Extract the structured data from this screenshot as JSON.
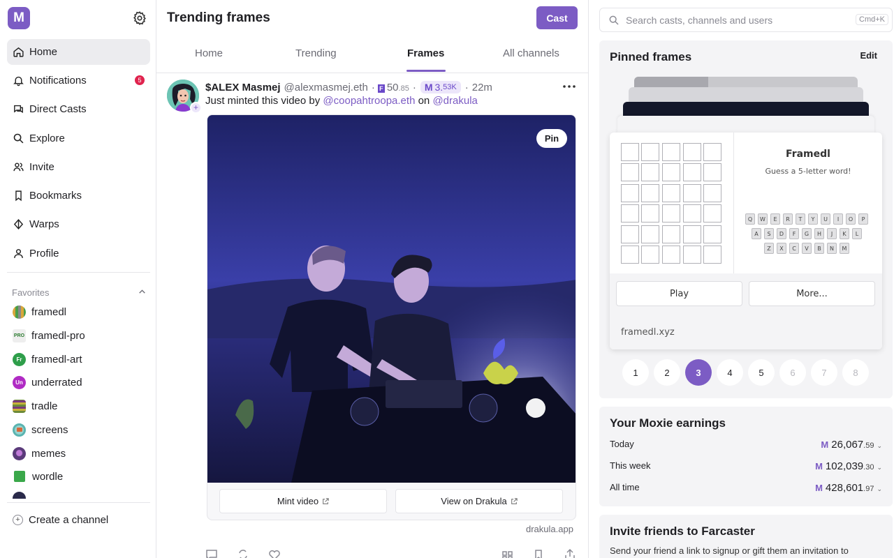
{
  "app": {
    "logo_letter": "M"
  },
  "sidebar": {
    "nav": [
      {
        "label": "Home",
        "icon": "home-icon"
      },
      {
        "label": "Notifications",
        "icon": "bell-icon",
        "badge": "5"
      },
      {
        "label": "Direct Casts",
        "icon": "chat-icon"
      },
      {
        "label": "Explore",
        "icon": "search-icon"
      },
      {
        "label": "Invite",
        "icon": "users-icon"
      },
      {
        "label": "Bookmarks",
        "icon": "bookmark-icon"
      },
      {
        "label": "Warps",
        "icon": "diamond-icon"
      },
      {
        "label": "Profile",
        "icon": "user-icon"
      }
    ],
    "favorites_label": "Favorites",
    "favorites": [
      {
        "label": "framedl",
        "icon_text": "",
        "color": "#d9a63a"
      },
      {
        "label": "framedl-pro",
        "icon_text": "PRO",
        "color": "#eeeeee"
      },
      {
        "label": "framedl-art",
        "icon_text": "Fr",
        "color": "#2e9e4a"
      },
      {
        "label": "underrated",
        "icon_text": "Un",
        "color": "#b02bc4"
      },
      {
        "label": "tradle",
        "icon_text": "",
        "color": "#6c8a3a"
      },
      {
        "label": "screens",
        "icon_text": "",
        "color": "#5ab4b0"
      },
      {
        "label": "memes",
        "icon_text": "",
        "color": "#5a3a7a"
      },
      {
        "label": "wordle",
        "icon_text": "",
        "color": "#3aa84a"
      }
    ],
    "create_channel": "Create a channel"
  },
  "main": {
    "title": "Trending frames",
    "cast_button": "Cast",
    "tabs": [
      "Home",
      "Trending",
      "Frames",
      "All channels"
    ],
    "active_tab": "Frames",
    "cast": {
      "display_name": "$ALEX Masmej",
      "username": "@alexmasmej.eth",
      "separator": "·",
      "fc_icon": "F",
      "fc_score_int": "50",
      "fc_score_dec": ".85",
      "moxie_icon": "M",
      "moxie_int": "3.",
      "moxie_dec": "53K",
      "time": "22m",
      "text_prefix": "Just minted this video by",
      "mention_1": "@coopahtroopa.eth",
      "text_mid": "on",
      "mention_2": "@drakula",
      "pin_label": "Pin",
      "buttons": [
        "Mint video",
        "View on Drakula"
      ],
      "frame_domain": "drakula.app"
    }
  },
  "right": {
    "search_placeholder": "Search casts, channels and users",
    "search_shortcut": "Cmd+K",
    "pinned": {
      "title": "Pinned frames",
      "edit": "Edit",
      "frame_title": "Framedl",
      "frame_subtitle": "Guess a 5-letter word!",
      "keyboard_rows": [
        [
          "Q",
          "W",
          "E",
          "R",
          "T",
          "Y",
          "U",
          "I",
          "O",
          "P"
        ],
        [
          "A",
          "S",
          "D",
          "F",
          "G",
          "H",
          "J",
          "K",
          "L"
        ],
        [
          "Z",
          "X",
          "C",
          "V",
          "B",
          "N",
          "M"
        ]
      ],
      "buttons": [
        "Play",
        "More..."
      ],
      "domain": "framedl.xyz",
      "pages": [
        "1",
        "2",
        "3",
        "4",
        "5",
        "6",
        "7",
        "8"
      ],
      "active_page": "3",
      "disabled_pages_from": 6
    },
    "earnings": {
      "title": "Your Moxie earnings",
      "currency_icon": "M",
      "rows": [
        {
          "label": "Today",
          "int": "26,067",
          "dec": ".59"
        },
        {
          "label": "This week",
          "int": "102,039",
          "dec": ".30"
        },
        {
          "label": "All time",
          "int": "428,601",
          "dec": ".97"
        }
      ]
    },
    "invite": {
      "title": "Invite friends to Farcaster",
      "text": "Send your friend a link to signup or gift them an invitation to"
    }
  }
}
